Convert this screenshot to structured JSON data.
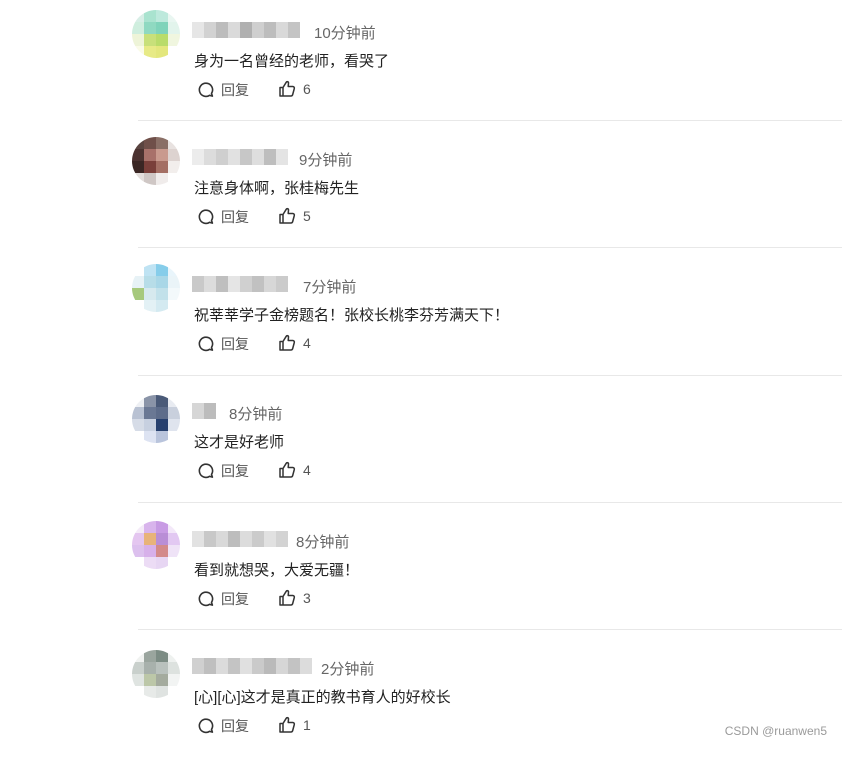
{
  "comments": [
    {
      "time": "10分钟前",
      "text": "身为一名曾经的老师，看哭了",
      "reply_label": "回复",
      "likes": "6"
    },
    {
      "time": "9分钟前",
      "text": "注意身体啊，张桂梅先生",
      "reply_label": "回复",
      "likes": "5"
    },
    {
      "time": "7分钟前",
      "text": "祝莘莘学子金榜题名！张校长桃李芬芳满天下！",
      "reply_label": "回复",
      "likes": "4"
    },
    {
      "time": "8分钟前",
      "text": "这才是好老师",
      "reply_label": "回复",
      "likes": "4"
    },
    {
      "time": "8分钟前",
      "text": "看到就想哭，大爱无疆！",
      "reply_label": "回复",
      "likes": "3"
    },
    {
      "time": "2分钟前",
      "text": "[心][心]这才是真正的教书育人的好校长",
      "reply_label": "回复",
      "likes": "1"
    }
  ],
  "watermark": "CSDN @ruanwen5"
}
